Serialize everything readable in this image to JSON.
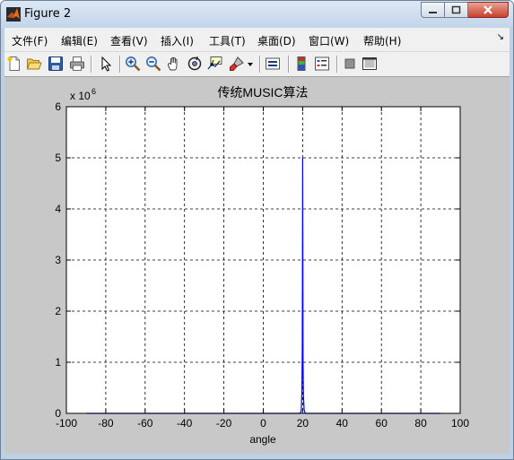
{
  "window": {
    "title": "Figure 2"
  },
  "menu": {
    "items": [
      "文件(F)",
      "编辑(E)",
      "查看(V)",
      "插入(I)",
      "工具(T)",
      "桌面(D)",
      "窗口(W)",
      "帮助(H)"
    ]
  },
  "toolbar": {
    "icons": [
      "new-figure-icon",
      "open-file-icon",
      "save-icon",
      "print-icon",
      "select-arrow-icon",
      "zoom-in-icon",
      "zoom-out-icon",
      "pan-hand-icon",
      "rotate-3d-icon",
      "data-cursor-icon",
      "brush-icon",
      "brush-dropdown-icon",
      "link-plot-icon",
      "colorbar-icon",
      "legend-icon",
      "hide-plot-tools-icon",
      "show-plot-tools-icon"
    ]
  },
  "colors": {
    "line": "#0000ff",
    "figure_bg": "#c8c8c8",
    "axes_bg": "#ffffff"
  },
  "chart_data": {
    "type": "line",
    "title": "传统MUSIC算法",
    "xlabel": "angle",
    "ylabel": "",
    "y_exponent_label": "x 10",
    "y_exponent": "6",
    "xlim": [
      -100,
      100
    ],
    "ylim": [
      0,
      6000000
    ],
    "xticks": [
      "-100",
      "-80",
      "-60",
      "-40",
      "-20",
      "0",
      "20",
      "40",
      "60",
      "80",
      "100"
    ],
    "yticks": [
      "0",
      "1",
      "2",
      "3",
      "4",
      "5",
      "6"
    ],
    "grid": true,
    "series": [
      {
        "x": [
          -90,
          18.0,
          18.6,
          19.0,
          19.3,
          19.6,
          19.8,
          19.9,
          20.0,
          20.1,
          20.2,
          20.4,
          20.7,
          21.0,
          21.5,
          90
        ],
        "y": [
          0,
          0,
          5000,
          20000,
          60000,
          400000,
          1200000,
          2800000,
          5000000,
          3300000,
          1000000,
          350000,
          90000,
          30000,
          0,
          0
        ]
      }
    ]
  }
}
